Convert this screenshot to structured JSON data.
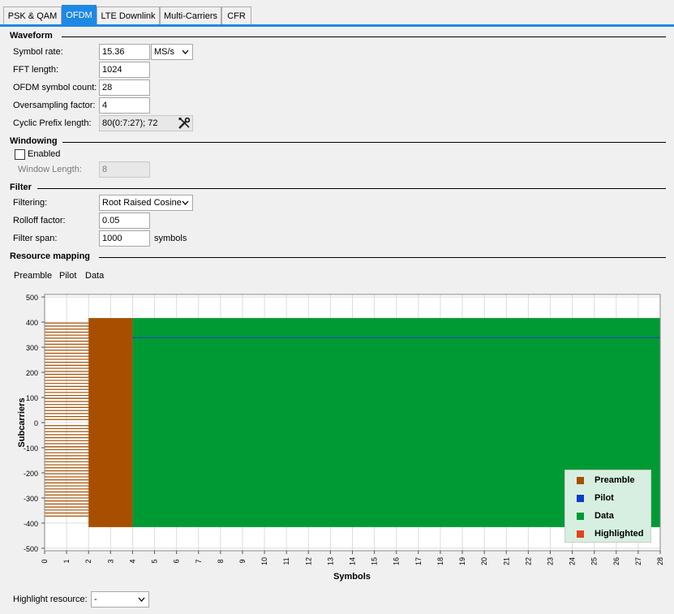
{
  "tabs": [
    {
      "label": "PSK & QAM",
      "active": false
    },
    {
      "label": "OFDM",
      "active": true
    },
    {
      "label": "LTE Downlink",
      "active": false
    },
    {
      "label": "Multi-Carriers",
      "active": false
    },
    {
      "label": "CFR",
      "active": false
    }
  ],
  "waveform": {
    "title": "Waveform",
    "symbol_rate_label": "Symbol rate:",
    "symbol_rate_value": "15.36",
    "symbol_rate_unit": "MS/s",
    "fft_length_label": "FFT length:",
    "fft_length_value": "1024",
    "symbol_count_label": "OFDM symbol count:",
    "symbol_count_value": "28",
    "oversampling_label": "Oversampling factor:",
    "oversampling_value": "4",
    "cp_label": "Cyclic Prefix length:",
    "cp_value": "80(0:7:27); 72"
  },
  "windowing": {
    "title": "Windowing",
    "enabled_label": "Enabled",
    "enabled": false,
    "window_length_label": "Window Length:",
    "window_length_value": "8"
  },
  "filter": {
    "title": "Filter",
    "filtering_label": "Filtering:",
    "filtering_value": "Root Raised Cosine",
    "rolloff_label": "Rolloff factor:",
    "rolloff_value": "0.05",
    "span_label": "Filter span:",
    "span_value": "1000",
    "span_unit": "symbols"
  },
  "resource_mapping": {
    "title": "Resource mapping",
    "toolbar": [
      "Preamble",
      "Pilot",
      "Data"
    ]
  },
  "highlight": {
    "label": "Highlight resource:",
    "value": "-"
  },
  "colors": {
    "accent": "#1e88e5",
    "preamble": "#a84e00",
    "pilot": "#0a3ec8",
    "data": "#009a35",
    "highlighted": "#e0441a"
  },
  "icons": {
    "cp_edit": "tools-icon"
  },
  "chart_data": {
    "type": "heatmap",
    "xlabel": "Symbols",
    "ylabel": "Subcarriers",
    "xlim": [
      0,
      28
    ],
    "ylim": [
      -510,
      510
    ],
    "xticks": [
      0,
      1,
      2,
      3,
      4,
      5,
      6,
      7,
      8,
      9,
      10,
      11,
      12,
      13,
      14,
      15,
      16,
      17,
      18,
      19,
      20,
      21,
      22,
      23,
      24,
      25,
      26,
      27,
      28
    ],
    "yticks": [
      500,
      400,
      300,
      200,
      100,
      0,
      -100,
      -200,
      -300,
      -400,
      -500
    ],
    "grid": true,
    "legend_position": "bottom-right",
    "legend": [
      "Preamble",
      "Pilot",
      "Data",
      "Highlighted"
    ],
    "regions": [
      {
        "resource": "Preamble",
        "x": [
          2,
          4
        ],
        "y": [
          -416,
          416
        ]
      },
      {
        "resource": "Data",
        "x": [
          4,
          28
        ],
        "y": [
          -416,
          416
        ]
      },
      {
        "resource": "Pilot",
        "x": [
          4,
          28
        ],
        "y": [
          338,
          338
        ]
      }
    ],
    "preamble_sparse_symbols": [
      0,
      2
    ],
    "preamble_sparse_subcarriers": [
      -372,
      -360,
      -348,
      -336,
      -324,
      -312,
      -300,
      -288,
      -276,
      -264,
      -252,
      -240,
      -228,
      -216,
      -204,
      -192,
      -180,
      -168,
      -156,
      -144,
      -132,
      -120,
      -108,
      -96,
      -84,
      -72,
      -60,
      -48,
      -36,
      -24,
      -12,
      12,
      24,
      36,
      48,
      60,
      72,
      84,
      96,
      108,
      120,
      132,
      144,
      156,
      168,
      180,
      192,
      204,
      216,
      228,
      240,
      252,
      264,
      276,
      288,
      300,
      312,
      324,
      336,
      348,
      360,
      372,
      384,
      396
    ]
  }
}
